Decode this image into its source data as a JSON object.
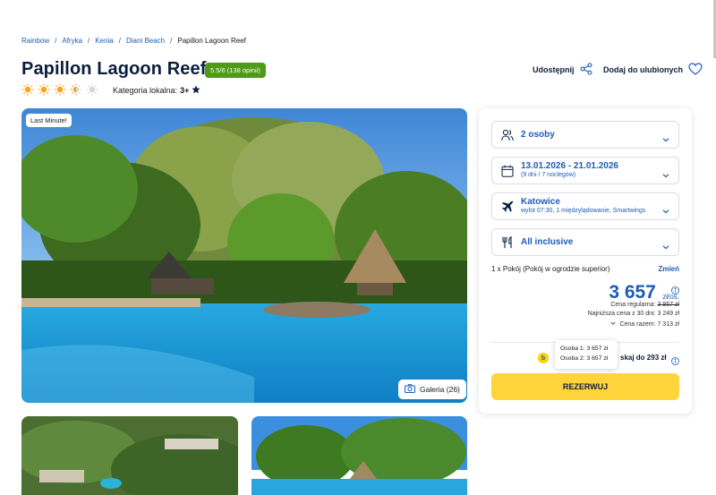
{
  "breadcrumb": {
    "items": [
      "Rainbow",
      "Afryka",
      "Kenia",
      "Diani Beach"
    ],
    "current": "Papillon Lagoon Reef"
  },
  "hotel": {
    "name": "Papillon Lagoon Reef",
    "rating_badge": "5.5/6 (138 opinii)",
    "suns": {
      "value": 4.5,
      "max": 5
    },
    "local_category_label": "Kategoria lokalna:",
    "local_category_value": "3+"
  },
  "actions": {
    "share_label": "Udostępnij",
    "favorite_label": "Dodaj do ulubionych"
  },
  "photo": {
    "badge": "Last Minute!",
    "gallery_label": "Galeria (26)"
  },
  "booking": {
    "persons": "2 osoby",
    "dates": "13.01.2026 - 21.01.2026",
    "dates_sub": "(9 dni / 7 noclegów)",
    "departure": "Katowice",
    "departure_sub": "wylot 07:30, 1 międzylądowanie, Smartwings",
    "board": "All inclusive",
    "room": "1 x Pokój  (Pokój w ogrodzie superior)",
    "room_change": "Zmień",
    "price": "3 657",
    "price_unit": "zł/os.",
    "regular_price_label": "Cena regularna:",
    "regular_price": "3 957 zł",
    "lowest_30d": "Najniższa cena z 30 dni: 3 249 zł",
    "total": "Cena razem: 7 313 zł",
    "tooltip_person1": "Osoba 1: 3 657 zł",
    "tooltip_person2": "Osoba 2: 3 657 zł",
    "save_text": "skaj do 293 zł",
    "book_button": "REZERWUJ"
  },
  "colors": {
    "brand_blue": "#1d5cb8",
    "rating_green": "#4d9b17",
    "cta_yellow": "#ffd43b",
    "sun_orange": "#f5a623"
  }
}
